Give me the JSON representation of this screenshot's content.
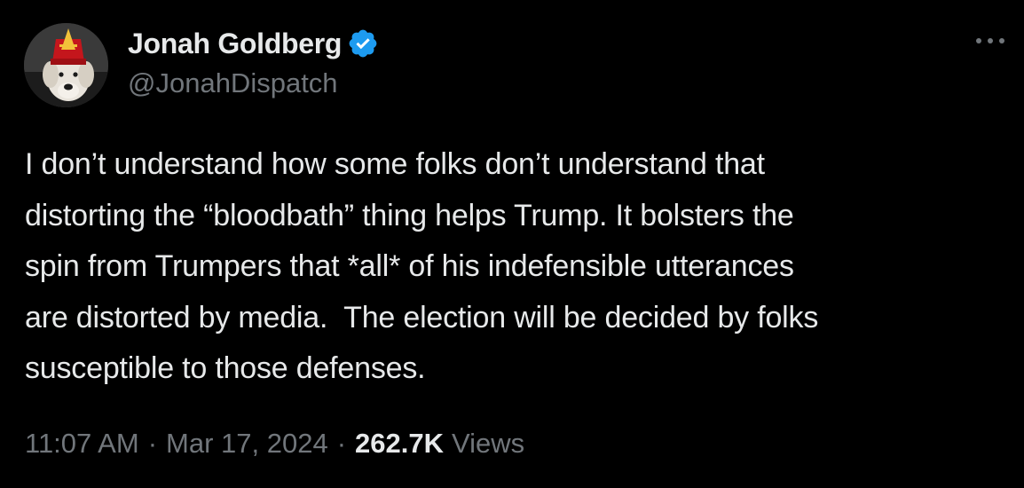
{
  "author": {
    "display_name": "Jonah Goldberg",
    "handle": "@JonahDispatch",
    "verified": true,
    "verified_color": "#1d9bf0",
    "avatar_icon": "dog-with-red-hat-avatar"
  },
  "more_icon": "ellipsis-icon",
  "tweet": {
    "lines": [
      "I don’t understand how some folks don’t understand that",
      "distorting the “bloodbath” thing helps Trump. It bolsters the",
      "spin from Trumpers that *all* of his indefensible utterances",
      "are distorted by media.  The election will be decided by folks",
      "susceptible to those defenses."
    ]
  },
  "meta": {
    "time": "11:07 AM",
    "separator": "·",
    "date": "Mar 17, 2024",
    "views_count": "262.7K",
    "views_label": "Views"
  },
  "colors": {
    "background": "#000000",
    "primary_text": "#e7e9ea",
    "secondary_text": "#71767b"
  }
}
